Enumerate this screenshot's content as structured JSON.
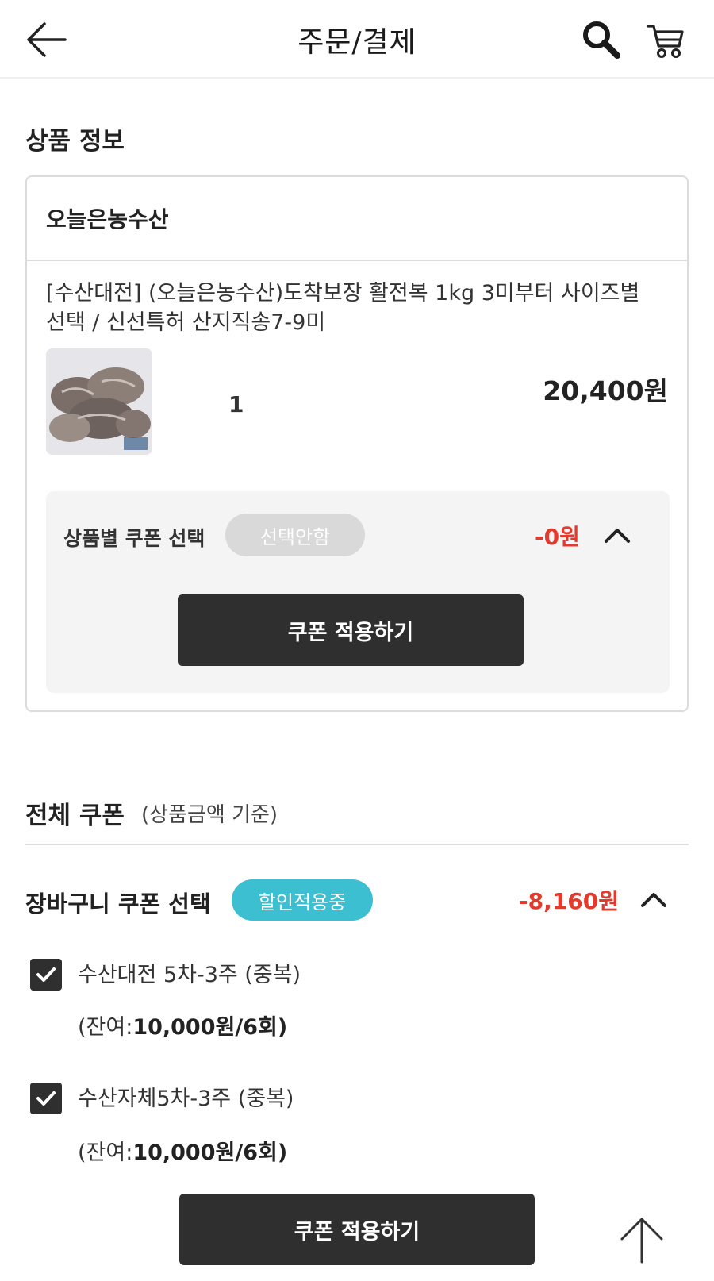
{
  "header": {
    "title": "주문/결제",
    "back_icon": "back-arrow-icon",
    "search_icon": "search-icon",
    "cart_icon": "cart-icon"
  },
  "product_section": {
    "title": "상품 정보",
    "seller": "오늘은농수산",
    "product_title": "[수산대전] (오늘은농수산)도착보장 활전복 1kg 3미부터 사이즈별 선택 / 신선특허 산지직송7-9미",
    "quantity": "1",
    "price": "20,400원",
    "coupon": {
      "label": "상품별 쿠폰 선택",
      "status": "선택안함",
      "discount": "-0원",
      "apply_button": "쿠폰 적용하기"
    }
  },
  "whole_coupon": {
    "title": "전체 쿠폰",
    "subtitle": "(상품금액 기준)",
    "cart_coupon": {
      "label": "장바구니 쿠폰 선택",
      "status": "할인적용중",
      "discount": "-8,160원"
    },
    "items": [
      {
        "name": "수산대전 5차-3주 (중복)",
        "remain_prefix": "(잔여:",
        "remain_value": "10,000원/6회",
        "remain_suffix": ")",
        "checked": true
      },
      {
        "name": "수산자체5차-3주 (중복)",
        "remain_prefix": "(잔여:",
        "remain_value": "10,000원/6회",
        "remain_suffix": ")",
        "checked": true
      }
    ],
    "apply_button": "쿠폰 적용하기"
  },
  "colors": {
    "accent_red": "#e23b2e",
    "teal": "#3bbfd1",
    "dark_button": "#2f2f2f"
  }
}
